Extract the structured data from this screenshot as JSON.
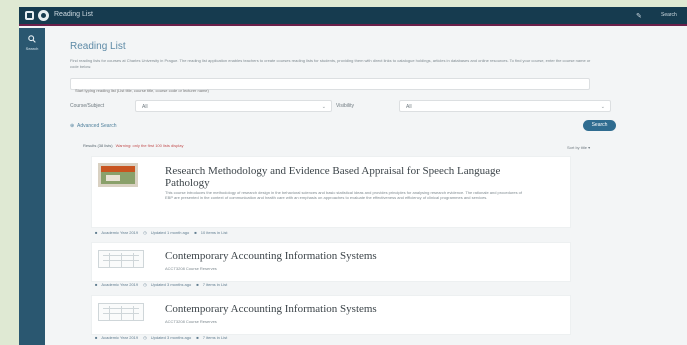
{
  "app": {
    "title": "Reading List",
    "top_icon": "✎",
    "top_link": "Search"
  },
  "sidebar": {
    "search_label": "Search"
  },
  "page": {
    "title": "Reading List",
    "intro": "Find reading lists for courses at Charles University in Prague. The reading list application enables teachers to create courses reading lists for students, providing them with direct links to catalogue holdings, articles in databases and online resources. To find your course, enter the course name or code below.",
    "search_placeholder": "Start typing reading list (List title, course title, course code or lecturer name)"
  },
  "filters": {
    "first_label": "Course/Subject",
    "first_value": "All",
    "second_label": "Visibility",
    "second_value": "All"
  },
  "advanced_search": "Advanced Search",
  "go_button": "Search",
  "results": {
    "count_text": "Results (38 lists)",
    "warning": "Warning: only the first 100 lists display"
  },
  "sort": {
    "label": "Sort by title",
    "chevron": "▾"
  },
  "cards": [
    {
      "title": "Research Methodology and Evidence Based Appraisal for Speech Language Pathology",
      "desc": "This course introduces the methodology of research design in the behavioral sciences and basic statistical ideas and provides principles for analysing research evidence. The rationale and procedures of EBP are presented in the context of communication and health care with an emphasis on approaches to evaluate the effectiveness and efficiency of clinical programmes and services.",
      "meta": [
        "Academic Year 2019",
        "Updated 1 month ago",
        "10 items in List"
      ]
    },
    {
      "title": "Contemporary Accounting Information Systems",
      "subtitle": "ACCT3208 Course Reserves",
      "meta": [
        "Academic Year 2019",
        "Updated 3 months ago",
        "7 items in List"
      ]
    },
    {
      "title": "Contemporary Accounting Information Systems",
      "subtitle": "ACCT3208 Course Reserves",
      "meta": [
        "Academic Year 2019",
        "Updated 3 months ago",
        "7 items in List"
      ]
    }
  ],
  "colors": {
    "header": "#163b4f",
    "sidebar": "#2a5770",
    "accent": "#5d8aa6",
    "button": "#2f6c90",
    "warning": "#c24f4f"
  }
}
